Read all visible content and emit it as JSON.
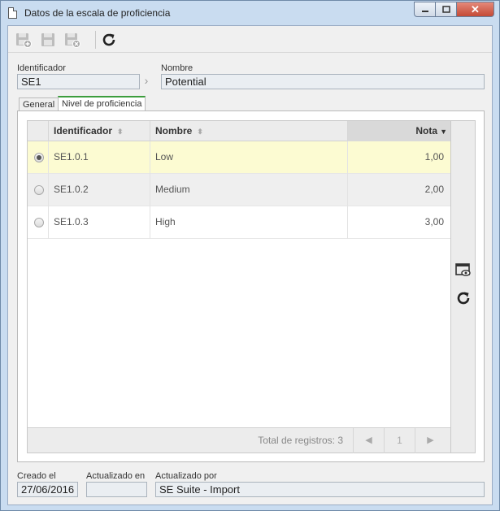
{
  "window": {
    "title": "Datos de la escala de proficiencia",
    "min_icon": "minimize-icon",
    "max_icon": "maximize-icon",
    "close_label": "✕"
  },
  "toolbar": {
    "buttons": [
      {
        "name": "save-new-icon"
      },
      {
        "name": "save-icon"
      },
      {
        "name": "save-close-icon"
      },
      {
        "name": "refresh-icon"
      }
    ]
  },
  "fields": {
    "identificador_label": "Identificador",
    "identificador_value": "SE1",
    "nombre_label": "Nombre",
    "nombre_value": "Potential"
  },
  "tabs": [
    {
      "label": "General",
      "active": false
    },
    {
      "label": "Nivel de proficiencia",
      "active": true
    }
  ],
  "grid": {
    "columns": [
      {
        "label": "Identificador"
      },
      {
        "label": "Nombre"
      },
      {
        "label": "Nota"
      }
    ],
    "rows": [
      {
        "id": "SE1.0.1",
        "nombre": "Low",
        "nota": "1,00",
        "selected": true
      },
      {
        "id": "SE1.0.2",
        "nombre": "Medium",
        "nota": "2,00",
        "selected": false
      },
      {
        "id": "SE1.0.3",
        "nombre": "High",
        "nota": "3,00",
        "selected": false
      }
    ],
    "footer": {
      "total_label": "Total de registros: 3",
      "page": "1"
    }
  },
  "footer": {
    "creado_label": "Creado el",
    "creado_value": "27/06/2016",
    "actualizado_en_label": "Actualizado en",
    "actualizado_en_value": "",
    "actualizado_por_label": "Actualizado por",
    "actualizado_por_value": "SE Suite - Import"
  },
  "colors": {
    "selected_row": "#fcfbd2",
    "alt_row": "#efefef",
    "active_tab_accent": "#3c9d3c"
  }
}
